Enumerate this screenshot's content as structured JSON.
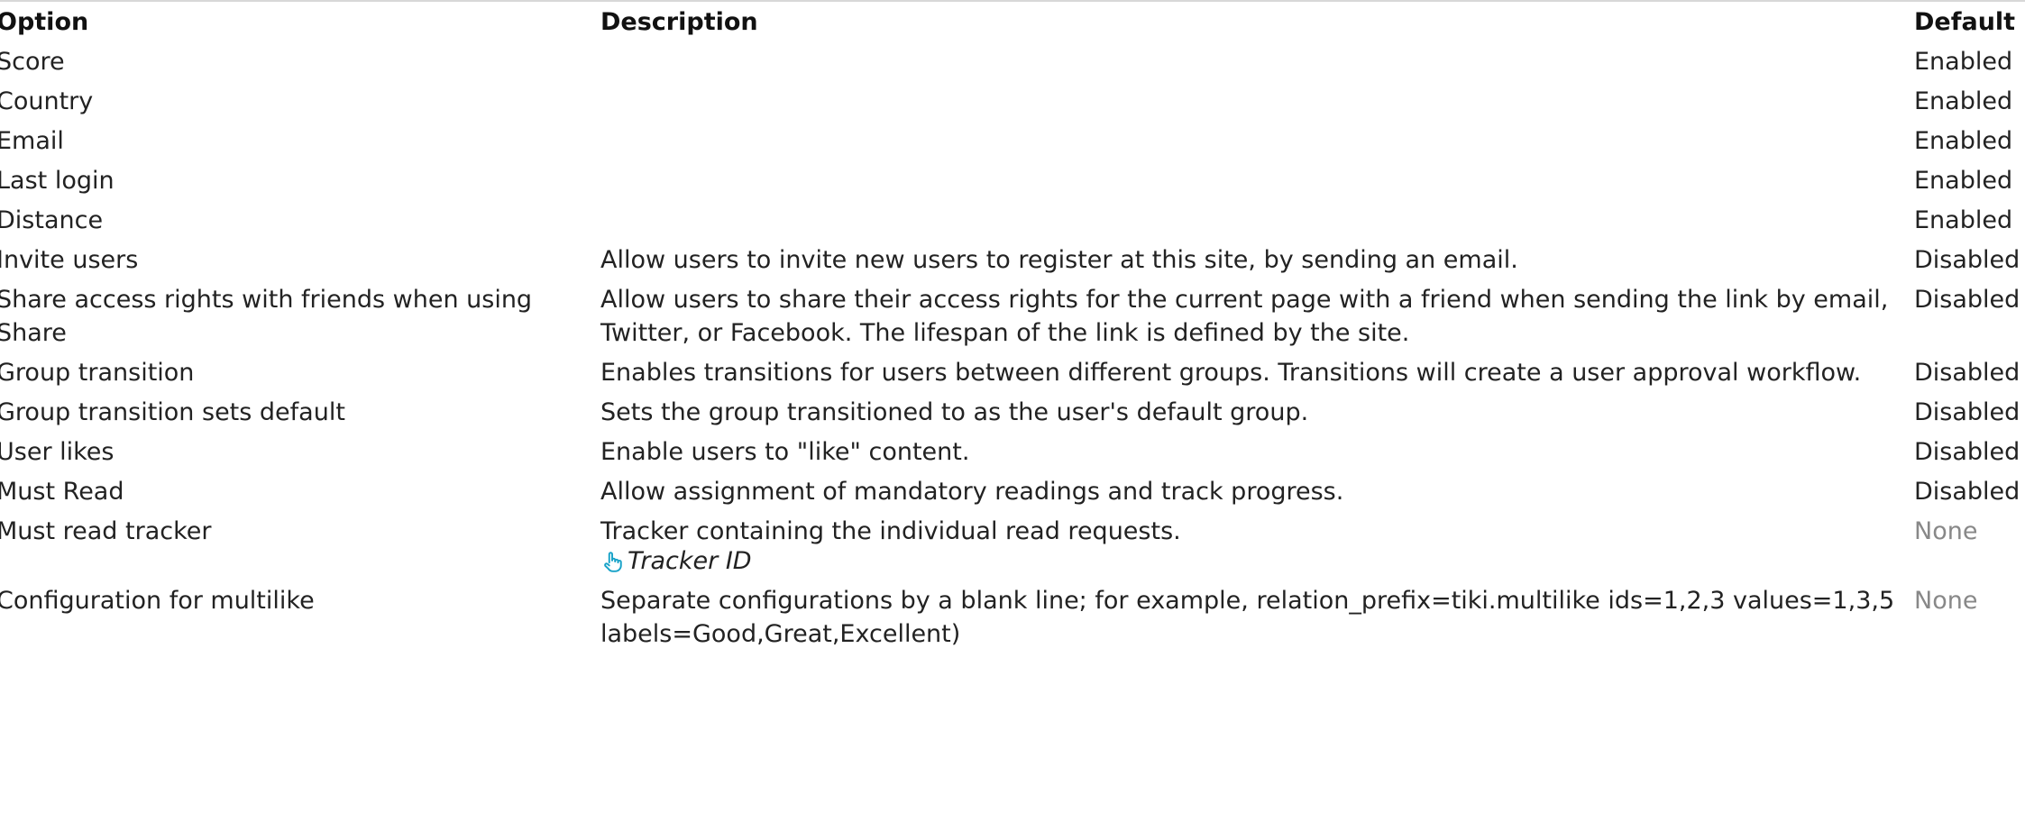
{
  "headers": {
    "option": "Option",
    "description": "Description",
    "default": "Default"
  },
  "rows": [
    {
      "option": "Score",
      "description": "",
      "default": "Enabled"
    },
    {
      "option": "Country",
      "description": "",
      "default": "Enabled"
    },
    {
      "option": "Email",
      "description": "",
      "default": "Enabled"
    },
    {
      "option": "Last login",
      "description": "",
      "default": "Enabled"
    },
    {
      "option": "Distance",
      "description": "",
      "default": "Enabled"
    },
    {
      "option": "Invite users",
      "description": "Allow users to invite new users to register at this site, by sending an email.",
      "default": "Disabled"
    },
    {
      "option": "Share access rights with friends when using Share",
      "description": "Allow users to share their access rights for the current page with a friend when sending the link by email, Twitter, or Facebook. The lifespan of the link is defined by the site.",
      "default": "Disabled"
    },
    {
      "option": "Group transition",
      "description": "Enables transitions for users between different groups. Transitions will create a user approval workflow.",
      "default": "Disabled"
    },
    {
      "option": "Group transition sets default",
      "description": "Sets the group transitioned to as the user's default group.",
      "default": "Disabled"
    },
    {
      "option": "User likes",
      "description": "Enable users to \"like\" content.",
      "default": "Disabled"
    },
    {
      "option": "Must Read",
      "description": "Allow assignment of mandatory readings and track progress.",
      "default": "Disabled"
    },
    {
      "option": "Must read tracker",
      "description": "Tracker containing the individual read requests.",
      "sublabel": "Tracker ID",
      "sublabel_icon": "pointer-hand-icon",
      "default": "None"
    },
    {
      "option": "Configuration for multilike",
      "description": "Separate configurations by a blank line; for example, relation_prefix=tiki.multilike ids=1,2,3 values=1,3,5 labels=Good,Great,Excellent)",
      "default": "None"
    }
  ],
  "colors": {
    "text": "#222222",
    "muted": "#888888",
    "icon": "#17a2c8"
  }
}
